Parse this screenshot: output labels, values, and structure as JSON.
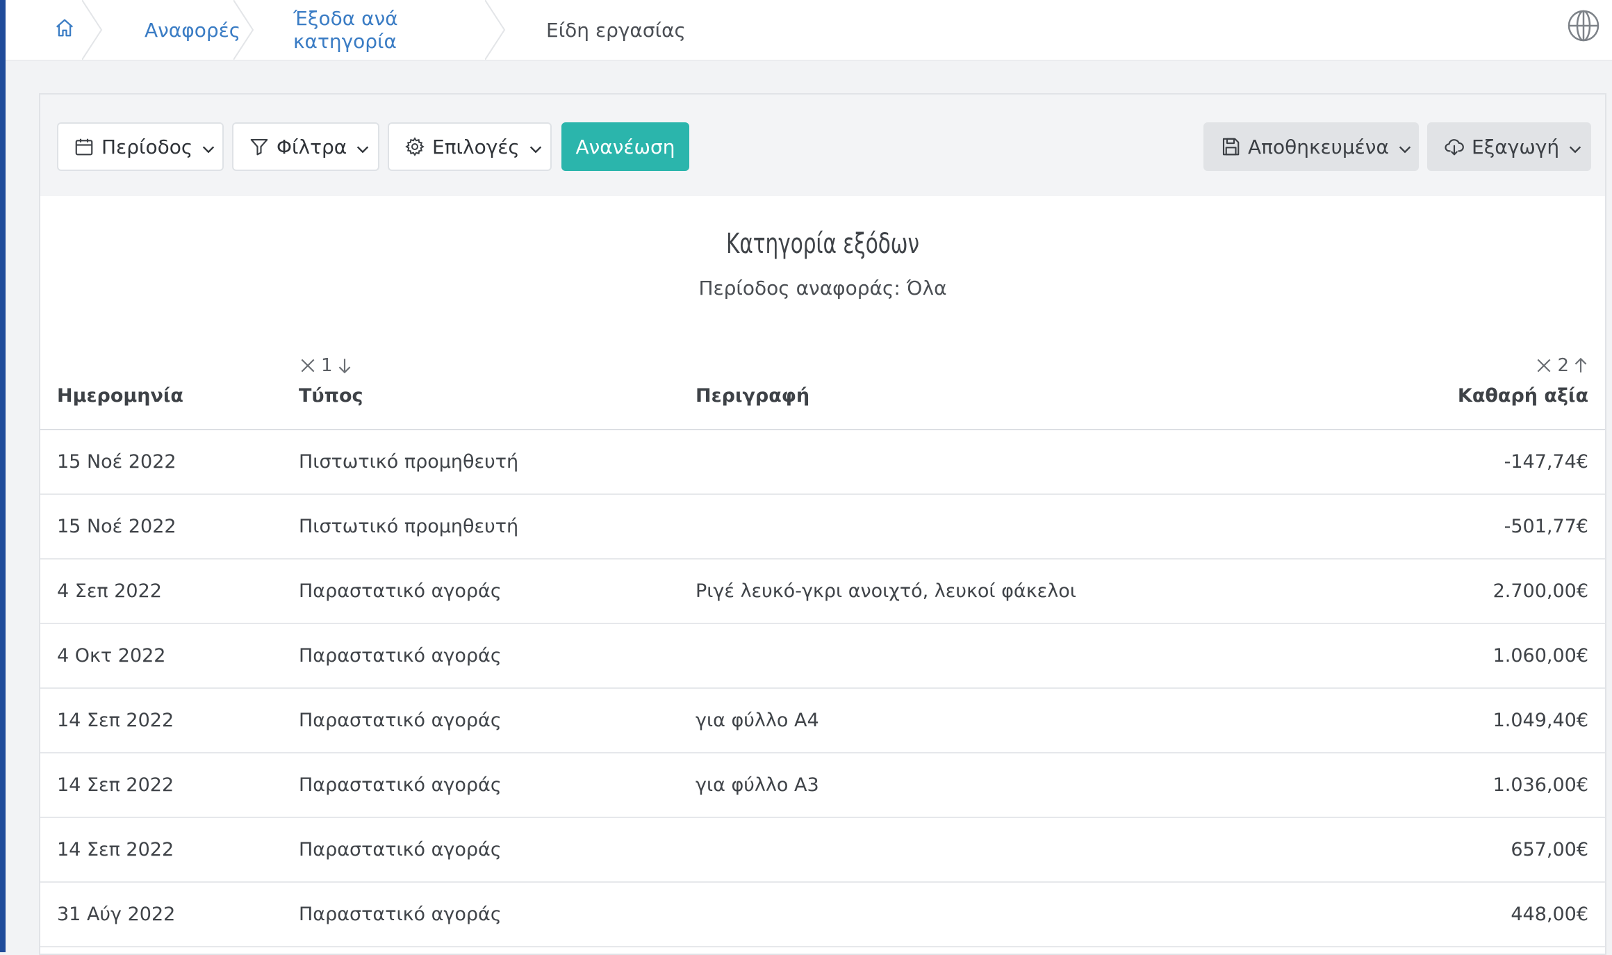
{
  "breadcrumb": {
    "home_icon": "home-icon",
    "items": [
      {
        "label": "Αναφορές"
      },
      {
        "label": "Έξοδα ανά κατηγορία"
      },
      {
        "label": "Είδη εργασίας"
      }
    ]
  },
  "header": {
    "globe_icon": "globe-icon"
  },
  "toolbar": {
    "period_label": "Περίοδος",
    "filters_label": "Φίλτρα",
    "options_label": "Επιλογές",
    "refresh_label": "Ανανέωση",
    "saved_label": "Αποθηκευμένα",
    "export_label": "Εξαγωγή"
  },
  "report": {
    "title": "Κατηγορία εξόδων",
    "subtitle": "Περίοδος αναφοράς: Όλα"
  },
  "table": {
    "columns": [
      {
        "label": "Ημερομηνία"
      },
      {
        "label": "Τύπος",
        "sort_order": "1",
        "sort_direction": "down"
      },
      {
        "label": "Περιγραφή"
      },
      {
        "label": "Καθαρή αξία",
        "sort_order": "2",
        "sort_direction": "up"
      }
    ],
    "rows": [
      {
        "date": "15 Νοέ 2022",
        "type": "Πιστωτικό προμηθευτή",
        "description": "",
        "amount": "-147,74€"
      },
      {
        "date": "15 Νοέ 2022",
        "type": "Πιστωτικό προμηθευτή",
        "description": "",
        "amount": "-501,77€"
      },
      {
        "date": "4 Σεπ 2022",
        "type": "Παραστατικό αγοράς",
        "description": "Ριγέ λευκό-γκρι ανοιχτό, λευκοί φάκελοι",
        "amount": "2.700,00€"
      },
      {
        "date": "4 Οκτ 2022",
        "type": "Παραστατικό αγοράς",
        "description": "",
        "amount": "1.060,00€"
      },
      {
        "date": "14 Σεπ 2022",
        "type": "Παραστατικό αγοράς",
        "description": "για φύλλο Α4",
        "amount": "1.049,40€"
      },
      {
        "date": "14 Σεπ 2022",
        "type": "Παραστατικό αγοράς",
        "description": "για φύλλο Α3",
        "amount": "1.036,00€"
      },
      {
        "date": "14 Σεπ 2022",
        "type": "Παραστατικό αγοράς",
        "description": "",
        "amount": "657,00€"
      },
      {
        "date": "31 Αύγ 2022",
        "type": "Παραστατικό αγοράς",
        "description": "",
        "amount": "448,00€"
      }
    ]
  },
  "colors": {
    "link": "#3a7cc4",
    "primary": "#2bb5ac",
    "accent_bar": "#1f4b9a"
  }
}
